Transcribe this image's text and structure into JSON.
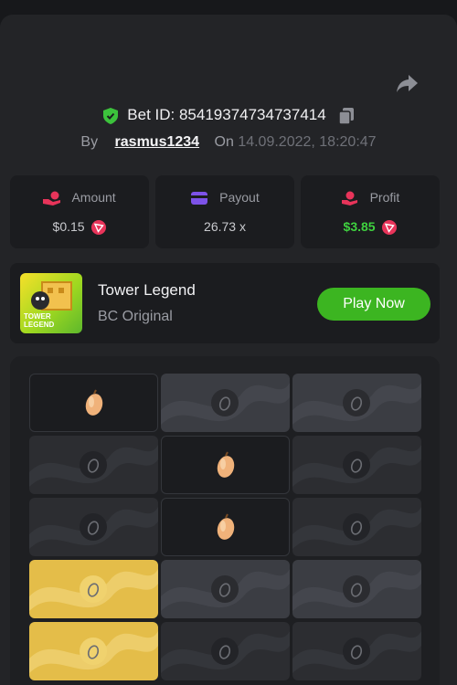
{
  "bet": {
    "id_label": "Bet ID: 85419374734737414",
    "by_label": "By",
    "username": "rasmus1234",
    "on_label": "On",
    "datetime": "14.09.2022, 18:20:47"
  },
  "stats": {
    "amount": {
      "label": "Amount",
      "value": "$0.15",
      "icon": "money-hand-icon"
    },
    "payout": {
      "label": "Payout",
      "value": "26.73 x",
      "icon": "wallet-icon"
    },
    "profit": {
      "label": "Profit",
      "value": "$3.85",
      "icon": "profit-icon"
    }
  },
  "game": {
    "title": "Tower Legend",
    "subtitle": "BC Original",
    "thumb_text_1": "TOWER",
    "thumb_text_2": "LEGEND",
    "play_label": "Play Now"
  },
  "colors": {
    "accent_green": "#3cb521",
    "profit_green": "#3fd13f",
    "gold_tile": "#e4bd49",
    "coin_red": "#e8345a"
  },
  "board": {
    "rows": [
      [
        "revealed-fruit",
        "hidden-light",
        "hidden-light"
      ],
      [
        "hidden-dark",
        "revealed-fruit",
        "hidden-dark"
      ],
      [
        "hidden-dark",
        "revealed-fruit",
        "hidden-dark"
      ],
      [
        "gold",
        "hidden-light",
        "hidden-light"
      ],
      [
        "gold",
        "hidden-dark",
        "hidden-dark"
      ]
    ]
  }
}
